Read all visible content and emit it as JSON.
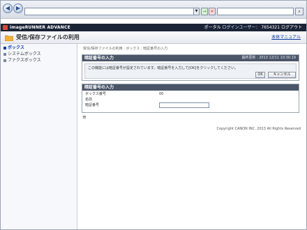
{
  "browser": {
    "address": "",
    "back_icon": "back-arrow-icon",
    "forward_icon": "forward-arrow-icon"
  },
  "app": {
    "name": "imageRUNNER ADVANCE",
    "user_label": "ポータル",
    "login_label": "ログインユーザー：",
    "user_name": "7654321",
    "logout_label": "ログアウト"
  },
  "page": {
    "title": "受信/保存ファイルの利用",
    "help_link": "本体マニュアル"
  },
  "sidebar": {
    "items": [
      {
        "label": "ボックス",
        "active": true
      },
      {
        "label": "システムボックス",
        "active": false
      },
      {
        "label": "ファクスボックス",
        "active": false
      }
    ]
  },
  "breadcrumb": "受信/保存ファイルの利用 : ボックス : 暗証番号の入力",
  "password_panel": {
    "heading": "暗証番号の入力",
    "datetime": "最終更新 : 2013 12/11 10:30:19",
    "message": "この機能には暗証番号が設定されています。暗証番号を入力して[OK]をクリックしてください。",
    "ok_label": "OK",
    "cancel_label": "キャンセル"
  },
  "input_panel": {
    "heading": "暗証番号の入力",
    "rows": [
      {
        "label": "ボックス番号",
        "value": "00"
      },
      {
        "label": "名前",
        "value": ""
      },
      {
        "label": "暗証番号",
        "value": ""
      }
    ]
  },
  "footer": "Copyright CANON INC. 2013 All Rights Reserved"
}
